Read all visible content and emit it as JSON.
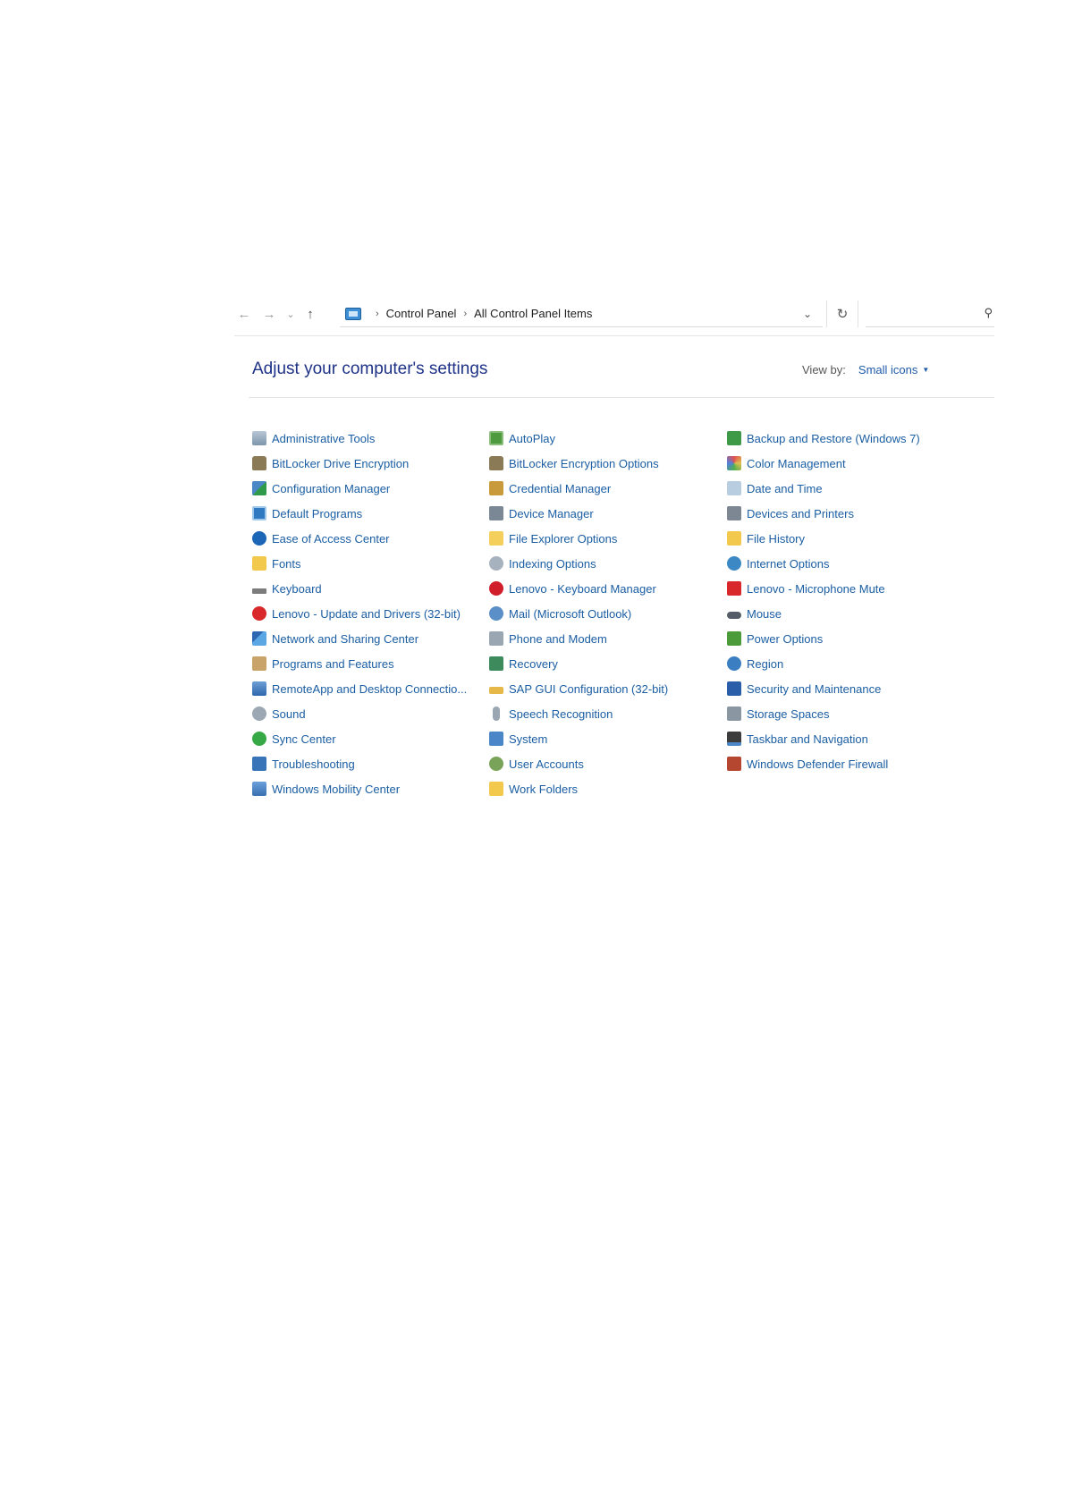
{
  "addressbar": {
    "back": "←",
    "forward": "→",
    "recent": "⌄",
    "up": "↑",
    "breadcrumbs": [
      "Control Panel",
      "All Control Panel Items"
    ],
    "separator": "›",
    "dropdown": "⌄",
    "refresh": "↻",
    "search_placeholder": "",
    "search_icon": "⚲"
  },
  "header": {
    "title": "Adjust your computer's settings",
    "view_by_label": "View by:",
    "view_by_value": "Small icons",
    "view_by_caret": "▼"
  },
  "items": [
    {
      "label": "Administrative Tools",
      "icon": "admin-tools-icon"
    },
    {
      "label": "BitLocker Drive Encryption",
      "icon": "bitlocker-icon"
    },
    {
      "label": "Configuration Manager",
      "icon": "configuration-manager-icon"
    },
    {
      "label": "Default Programs",
      "icon": "default-programs-icon"
    },
    {
      "label": "Ease of Access Center",
      "icon": "ease-of-access-icon"
    },
    {
      "label": "Fonts",
      "icon": "fonts-icon"
    },
    {
      "label": "Keyboard",
      "icon": "keyboard-icon"
    },
    {
      "label": "Lenovo - Update and Drivers (32-bit)",
      "icon": "lenovo-update-icon"
    },
    {
      "label": "Network and Sharing Center",
      "icon": "network-icon"
    },
    {
      "label": "Programs and Features",
      "icon": "programs-icon"
    },
    {
      "label": "RemoteApp and Desktop Connectio...",
      "icon": "remoteapp-icon"
    },
    {
      "label": "Sound",
      "icon": "sound-icon"
    },
    {
      "label": "Sync Center",
      "icon": "sync-center-icon"
    },
    {
      "label": "Troubleshooting",
      "icon": "troubleshooting-icon"
    },
    {
      "label": "Windows Mobility Center",
      "icon": "mobility-center-icon"
    },
    {
      "label": "AutoPlay",
      "icon": "autoplay-icon"
    },
    {
      "label": "BitLocker Encryption Options",
      "icon": "bitlocker-options-icon"
    },
    {
      "label": "Credential Manager",
      "icon": "credential-manager-icon"
    },
    {
      "label": "Device Manager",
      "icon": "device-manager-icon"
    },
    {
      "label": "File Explorer Options",
      "icon": "file-explorer-options-icon"
    },
    {
      "label": "Indexing Options",
      "icon": "indexing-options-icon"
    },
    {
      "label": "Lenovo - Keyboard Manager",
      "icon": "lenovo-keyboard-icon"
    },
    {
      "label": "Mail (Microsoft Outlook)",
      "icon": "mail-icon"
    },
    {
      "label": "Phone and Modem",
      "icon": "phone-modem-icon"
    },
    {
      "label": "Recovery",
      "icon": "recovery-icon"
    },
    {
      "label": "SAP GUI Configuration (32-bit)",
      "icon": "sap-gui-icon"
    },
    {
      "label": "Speech Recognition",
      "icon": "microphone-icon"
    },
    {
      "label": "System",
      "icon": "system-icon"
    },
    {
      "label": "User Accounts",
      "icon": "user-accounts-icon"
    },
    {
      "label": "Work Folders",
      "icon": "work-folders-icon"
    },
    {
      "label": "Backup and Restore (Windows 7)",
      "icon": "backup-restore-icon"
    },
    {
      "label": "Color Management",
      "icon": "color-management-icon"
    },
    {
      "label": "Date and Time",
      "icon": "date-time-icon"
    },
    {
      "label": "Devices and Printers",
      "icon": "printer-icon"
    },
    {
      "label": "File History",
      "icon": "file-history-icon"
    },
    {
      "label": "Internet Options",
      "icon": "internet-options-icon"
    },
    {
      "label": "Lenovo - Microphone Mute",
      "icon": "lenovo-mic-mute-icon"
    },
    {
      "label": "Mouse",
      "icon": "mouse-icon"
    },
    {
      "label": "Power Options",
      "icon": "power-options-icon"
    },
    {
      "label": "Region",
      "icon": "region-icon"
    },
    {
      "label": "Security and Maintenance",
      "icon": "security-flag-icon"
    },
    {
      "label": "Storage Spaces",
      "icon": "storage-spaces-icon"
    },
    {
      "label": "Taskbar and Navigation",
      "icon": "taskbar-icon"
    },
    {
      "label": "Windows Defender Firewall",
      "icon": "firewall-icon"
    }
  ],
  "colors": {
    "link": "#1b5ea3",
    "heading": "#1e3287",
    "view_value": "#1e5aa8"
  }
}
